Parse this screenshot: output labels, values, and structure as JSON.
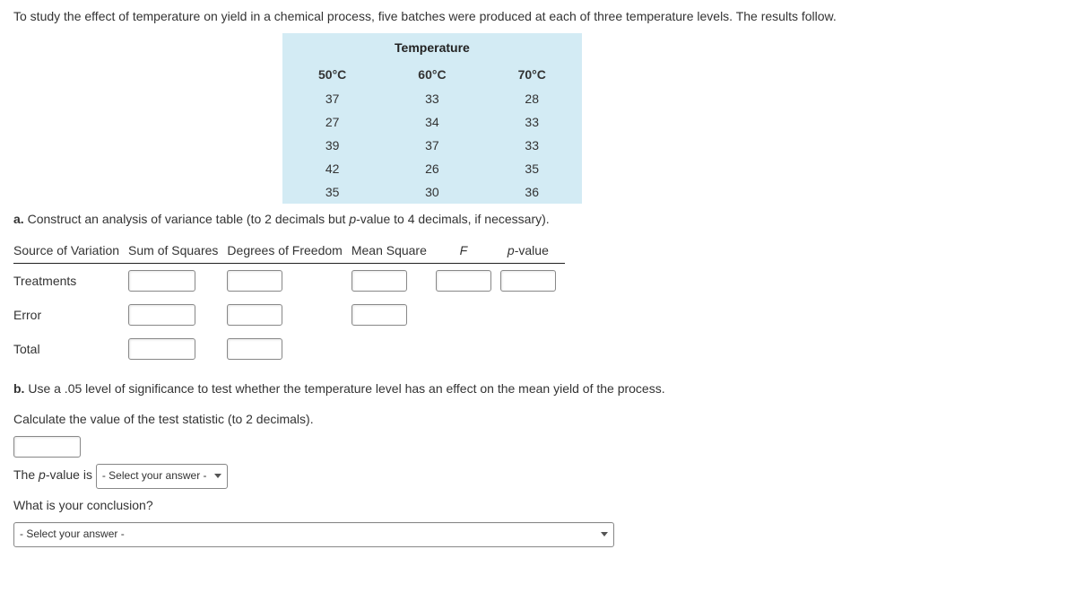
{
  "intro": "To study the effect of temperature on yield in a chemical process, five batches were produced at each of three temperature levels. The results follow.",
  "dataTable": {
    "superHeader": "Temperature",
    "cols": [
      "50°C",
      "60°C",
      "70°C"
    ],
    "rows": [
      [
        "37",
        "33",
        "28"
      ],
      [
        "27",
        "34",
        "33"
      ],
      [
        "39",
        "37",
        "33"
      ],
      [
        "42",
        "26",
        "35"
      ],
      [
        "35",
        "30",
        "36"
      ]
    ]
  },
  "partA": {
    "label": "a.",
    "text_before_ital": " Construct an analysis of variance table (to 2 decimals but ",
    "ital": "p",
    "text_after_ital": "-value to 4 decimals, if necessary)."
  },
  "anovaHeaders": {
    "source": "Source of Variation",
    "ss": "Sum of Squares",
    "df": "Degrees of Freedom",
    "ms": "Mean Square",
    "f": "F",
    "pval_ital": "p",
    "pval_rest": "-value"
  },
  "anovaRows": {
    "treatments": "Treatments",
    "error": "Error",
    "total": "Total"
  },
  "partB": {
    "label": "b.",
    "text": " Use a .05 level of significance to test whether the temperature level has an effect on the mean yield of the process."
  },
  "calcLine": "Calculate the value of the test statistic (to 2 decimals).",
  "pvalLine": {
    "before_ital": "The ",
    "ital": "p",
    "after_ital": "-value is"
  },
  "selectPlaceholder1": "- Select your answer -",
  "conclusionQ": "What is your conclusion?",
  "selectPlaceholder2": "- Select your answer -"
}
